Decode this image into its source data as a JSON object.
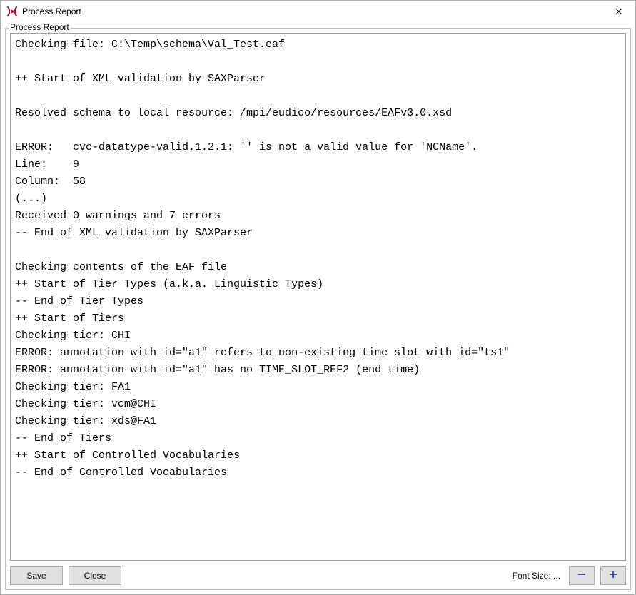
{
  "window": {
    "title": "Process Report"
  },
  "groupbox": {
    "label": "Process Report"
  },
  "report_lines": [
    "Checking file: C:\\Temp\\schema\\Val_Test.eaf",
    "",
    "++ Start of XML validation by SAXParser",
    "",
    "Resolved schema to local resource: /mpi/eudico/resources/EAFv3.0.xsd",
    "",
    "ERROR:   cvc-datatype-valid.1.2.1: '' is not a valid value for 'NCName'.",
    "Line:    9",
    "Column:  58",
    "(...)",
    "Received 0 warnings and 7 errors",
    "-- End of XML validation by SAXParser",
    "",
    "Checking contents of the EAF file",
    "++ Start of Tier Types (a.k.a. Linguistic Types)",
    "-- End of Tier Types",
    "++ Start of Tiers",
    "Checking tier: CHI",
    "ERROR: annotation with id=\"a1\" refers to non-existing time slot with id=\"ts1\"",
    "ERROR: annotation with id=\"a1\" has no TIME_SLOT_REF2 (end time)",
    "Checking tier: FA1",
    "Checking tier: vcm@CHI",
    "Checking tier: xds@FA1",
    "-- End of Tiers",
    "++ Start of Controlled Vocabularies",
    "-- End of Controlled Vocabularies"
  ],
  "buttons": {
    "save": "Save",
    "close": "Close",
    "font_size_label": "Font Size: ..."
  }
}
